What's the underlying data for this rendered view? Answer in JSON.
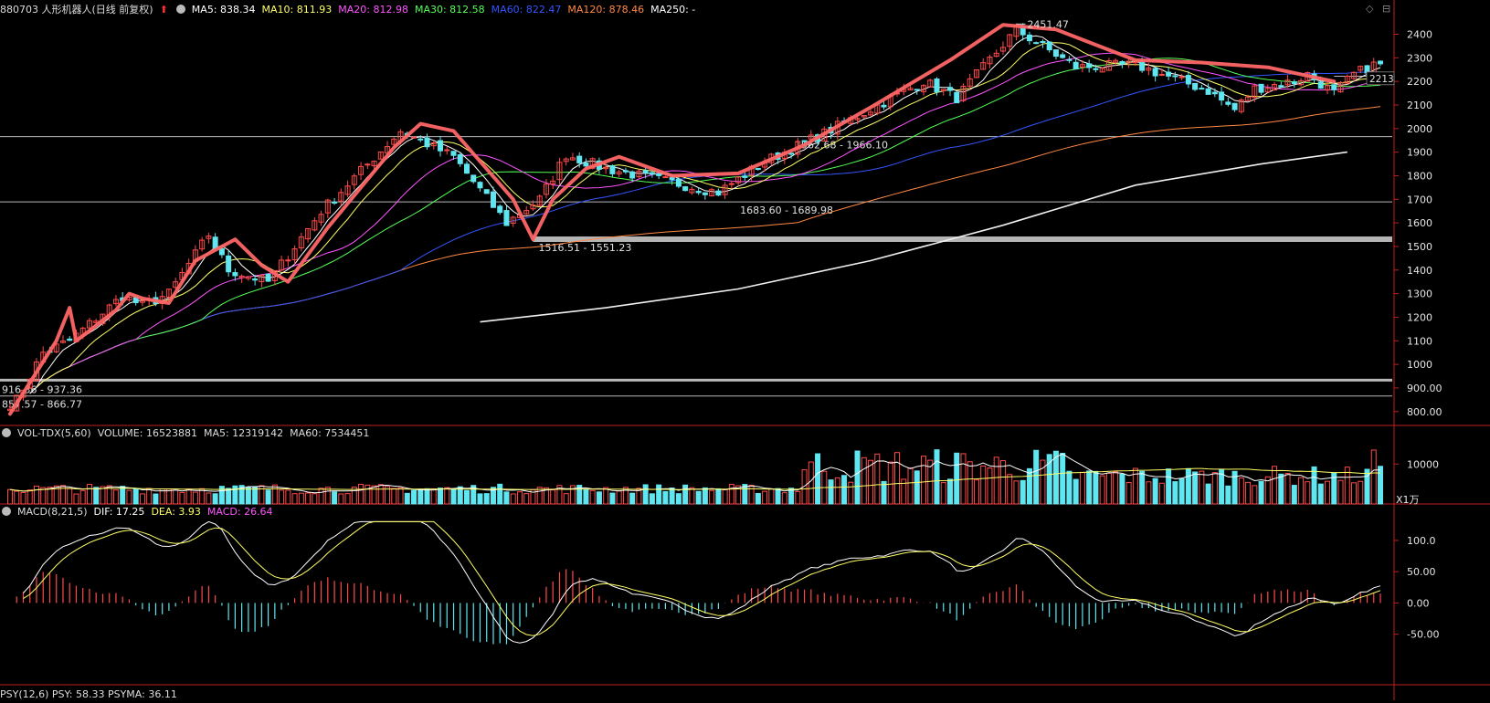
{
  "header": {
    "title": "880703 人形机器人(日线 前复权)",
    "up_icon": "arrow-up-icon",
    "ma_items": [
      {
        "label": "MA5: 838.34",
        "color": "#ffffff"
      },
      {
        "label": "MA10: 811.93",
        "color": "#ffff66"
      },
      {
        "label": "MA20: 812.98",
        "color": "#ff55ff"
      },
      {
        "label": "MA30: 812.58",
        "color": "#55ff55"
      },
      {
        "label": "MA60: 822.47",
        "color": "#3355ff"
      },
      {
        "label": "MA120: 878.46",
        "color": "#ff8844"
      },
      {
        "label": "MA250: -",
        "color": "#ffffff"
      }
    ]
  },
  "volume_header": {
    "items": [
      {
        "label": "VOL-TDX(5,60)",
        "color": "#dddddd"
      },
      {
        "label": "VOLUME: 16523881",
        "color": "#dddddd"
      },
      {
        "label": "MA5: 12319142",
        "color": "#dddddd"
      },
      {
        "label": "MA60: 7534451",
        "color": "#dddddd"
      }
    ]
  },
  "macd_header": {
    "items": [
      {
        "label": "MACD(8,21,5)",
        "color": "#dddddd"
      },
      {
        "label": "DIF: 17.25",
        "color": "#ffffff"
      },
      {
        "label": "DEA: 3.93",
        "color": "#ffff66"
      },
      {
        "label": "MACD: 26.64",
        "color": "#ff55ff"
      }
    ]
  },
  "bottom_header": {
    "label": "PSY(12,6)  PSY: 58.33  PSYMA: 36.11"
  },
  "toolbar": {
    "diamond": "◇",
    "collapse": "⊟"
  },
  "colors": {
    "up": "#ff4a4a",
    "down": "#5fe6f0",
    "trend": "#ff6666",
    "axis": "#c02020"
  },
  "chart_data": {
    "type": "candlestick",
    "price_axis": {
      "ticks": [
        800,
        900,
        1000,
        1100,
        1200,
        1300,
        1400,
        1500,
        1600,
        1700,
        1800,
        1900,
        2000,
        2100,
        2200,
        2300,
        2400
      ],
      "tick_labels": [
        "800.00",
        "900.00",
        "1000",
        "1100",
        "1200",
        "1300",
        "1400",
        "1500",
        "1600",
        "1700",
        "1800",
        "1900",
        "2000",
        "2100",
        "2200",
        "2300",
        "2400"
      ],
      "range": [
        772,
        2460
      ]
    },
    "support_lines": [
      {
        "value": 933,
        "label": "916.36 - 937.36",
        "color": "#cccccc",
        "width": 3
      },
      {
        "value": 866,
        "label": "857.57 - 866.77",
        "color": "#cccccc",
        "width": 1
      },
      {
        "value": 1531,
        "label": "1516.51 - 1551.23",
        "color": "#c8c8c8",
        "width": 6
      },
      {
        "value": 1689,
        "label": "1683.60 - 1689.98",
        "color": "#cccccc",
        "width": 1
      },
      {
        "value": 1966,
        "label": "1962.68 - 1966.10",
        "color": "#cccccc",
        "width": 1
      },
      {
        "value": 2222,
        "label": "",
        "color": "#cccccc",
        "width": 1
      }
    ],
    "annotations": [
      {
        "label": "2451.47",
        "value": 2451
      },
      {
        "label": "2213",
        "value": 2213
      }
    ],
    "price_path": [
      [
        0,
        800
      ],
      [
        5,
        1050
      ],
      [
        9,
        1100
      ],
      [
        17,
        1290
      ],
      [
        20,
        1250
      ],
      [
        24,
        1300
      ],
      [
        30,
        1550
      ],
      [
        33,
        1400
      ],
      [
        39,
        1350
      ],
      [
        47,
        1650
      ],
      [
        59,
        1990
      ],
      [
        67,
        1880
      ],
      [
        75,
        1600
      ],
      [
        80,
        1700
      ],
      [
        84,
        1890
      ],
      [
        90,
        1830
      ],
      [
        107,
        1730
      ],
      [
        114,
        1860
      ],
      [
        123,
        1980
      ],
      [
        138,
        2200
      ],
      [
        143,
        2130
      ],
      [
        152,
        2420
      ],
      [
        161,
        2260
      ],
      [
        170,
        2270
      ],
      [
        181,
        2160
      ],
      [
        185,
        2080
      ],
      [
        188,
        2170
      ],
      [
        194,
        2200
      ],
      [
        196,
        2230
      ],
      [
        200,
        2150
      ],
      [
        203,
        2230
      ],
      [
        206,
        2270
      ]
    ],
    "trend_line": [
      [
        0,
        790
      ],
      [
        7,
        1100
      ],
      [
        9,
        1240
      ],
      [
        10,
        1100
      ],
      [
        16,
        1230
      ],
      [
        18,
        1300
      ],
      [
        20,
        1280
      ],
      [
        24,
        1260
      ],
      [
        28,
        1440
      ],
      [
        34,
        1530
      ],
      [
        38,
        1420
      ],
      [
        42,
        1350
      ],
      [
        48,
        1580
      ],
      [
        58,
        1920
      ],
      [
        62,
        2020
      ],
      [
        67,
        1990
      ],
      [
        76,
        1700
      ],
      [
        79,
        1530
      ],
      [
        82,
        1700
      ],
      [
        87,
        1830
      ],
      [
        92,
        1880
      ],
      [
        100,
        1800
      ],
      [
        110,
        1810
      ],
      [
        120,
        1930
      ],
      [
        130,
        2090
      ],
      [
        142,
        2290
      ],
      [
        150,
        2440
      ],
      [
        158,
        2420
      ],
      [
        170,
        2290
      ],
      [
        180,
        2280
      ],
      [
        190,
        2260
      ],
      [
        195,
        2230
      ],
      [
        200,
        2200
      ]
    ],
    "ma250": [
      [
        71,
        1180
      ],
      [
        90,
        1240
      ],
      [
        110,
        1320
      ],
      [
        130,
        1440
      ],
      [
        150,
        1590
      ],
      [
        170,
        1760
      ],
      [
        189,
        1850
      ],
      [
        202,
        1900
      ]
    ],
    "volume_axis": {
      "tick": 10000,
      "tick_label": "10000",
      "unit_label": "X1万",
      "max": 16000
    },
    "macd_axis": {
      "ticks": [
        100,
        50,
        0,
        -50
      ],
      "tick_labels": [
        "100.0",
        "50.00",
        "0.00",
        "-50.00"
      ],
      "range": [
        -125,
        135
      ]
    }
  }
}
